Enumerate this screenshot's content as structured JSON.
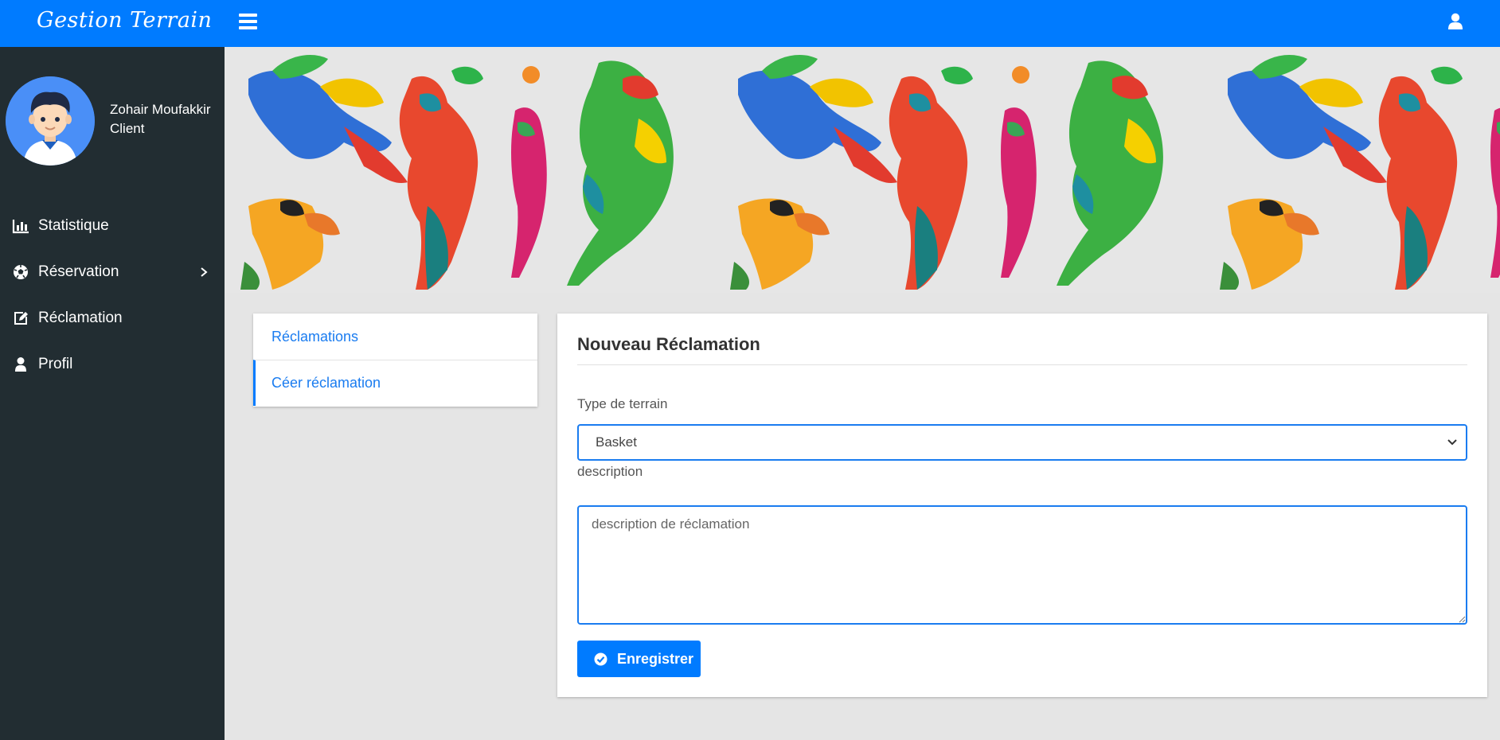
{
  "app": {
    "brand": "Gestion Terrain",
    "user_icon": "user-icon",
    "menu_toggle_icon": "hamburger-icon"
  },
  "sidebar": {
    "user": {
      "name": "Zohair Moufakkir",
      "role": "Client"
    },
    "items": [
      {
        "label": "Statistique",
        "icon": "bar-chart-icon"
      },
      {
        "label": "Réservation",
        "icon": "soccer-ball-icon",
        "has_submenu": true
      },
      {
        "label": "Réclamation",
        "icon": "edit-icon"
      },
      {
        "label": "Profil",
        "icon": "user-icon"
      }
    ]
  },
  "tabs": [
    {
      "label": "Réclamations",
      "active": false
    },
    {
      "label": "Céer réclamation",
      "active": true
    }
  ],
  "form": {
    "title": "Nouveau Réclamation",
    "type_label": "Type de terrain",
    "type_value": "Basket",
    "description_label": "description",
    "description_placeholder": "description de réclamation",
    "submit_label": "Enregistrer"
  },
  "colors": {
    "primary": "#007bff",
    "sidebar": "#222d32",
    "page_bg": "#e5e5e5",
    "link": "#1a7cf0"
  }
}
